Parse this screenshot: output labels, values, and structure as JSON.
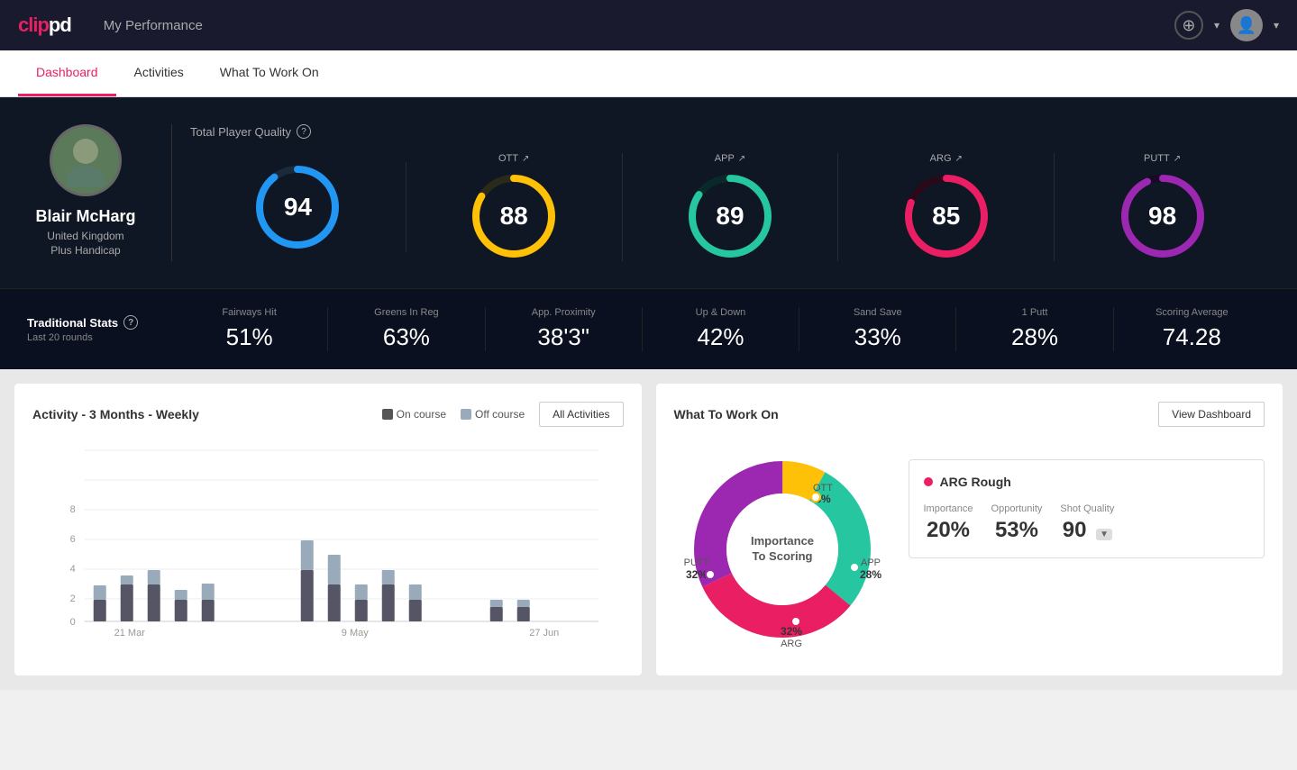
{
  "header": {
    "logo": "clippd",
    "title": "My Performance",
    "add_icon": "+",
    "avatar_icon": "👤"
  },
  "nav": {
    "tabs": [
      {
        "label": "Dashboard",
        "active": true
      },
      {
        "label": "Activities",
        "active": false
      },
      {
        "label": "What To Work On",
        "active": false
      }
    ]
  },
  "player": {
    "name": "Blair McHarg",
    "country": "United Kingdom",
    "handicap": "Plus Handicap",
    "avatar_icon": "🧍"
  },
  "quality": {
    "title": "Total Player Quality",
    "scores": [
      {
        "label": "TPQ",
        "value": "94",
        "color": "#2196f3",
        "percent": 94
      },
      {
        "label": "OTT",
        "value": "88",
        "color": "#ffc107",
        "percent": 88
      },
      {
        "label": "APP",
        "value": "89",
        "color": "#26c6a0",
        "percent": 89
      },
      {
        "label": "ARG",
        "value": "85",
        "color": "#e91e63",
        "percent": 85
      },
      {
        "label": "PUTT",
        "value": "98",
        "color": "#9c27b0",
        "percent": 98
      }
    ]
  },
  "trad_stats": {
    "title": "Traditional Stats",
    "info": "?",
    "subtitle": "Last 20 rounds",
    "stats": [
      {
        "label": "Fairways Hit",
        "value": "51%"
      },
      {
        "label": "Greens In Reg",
        "value": "63%"
      },
      {
        "label": "App. Proximity",
        "value": "38'3\""
      },
      {
        "label": "Up & Down",
        "value": "42%"
      },
      {
        "label": "Sand Save",
        "value": "33%"
      },
      {
        "label": "1 Putt",
        "value": "28%"
      },
      {
        "label": "Scoring Average",
        "value": "74.28"
      }
    ]
  },
  "activity_chart": {
    "title": "Activity - 3 Months - Weekly",
    "legend": {
      "on_course": "On course",
      "off_course": "Off course"
    },
    "all_activities_btn": "All Activities",
    "x_labels": [
      "21 Mar",
      "9 May",
      "27 Jun"
    ],
    "y_labels": [
      "0",
      "2",
      "4",
      "6",
      "8"
    ]
  },
  "work_on": {
    "title": "What To Work On",
    "view_dashboard_btn": "View Dashboard",
    "donut_center_line1": "Importance",
    "donut_center_line2": "To Scoring",
    "segments": [
      {
        "label": "OTT",
        "value": "8%",
        "color": "#ffc107"
      },
      {
        "label": "APP",
        "value": "28%",
        "color": "#26c6a0"
      },
      {
        "label": "ARG",
        "value": "32%",
        "color": "#e91e63"
      },
      {
        "label": "PUTT",
        "value": "32%",
        "color": "#9c27b0"
      }
    ],
    "detail": {
      "name": "ARG Rough",
      "dot_color": "#e91e63",
      "stats": [
        {
          "label": "Importance",
          "value": "20%"
        },
        {
          "label": "Opportunity",
          "value": "53%"
        },
        {
          "label": "Shot Quality",
          "value": "90",
          "badge": "▼"
        }
      ]
    }
  }
}
